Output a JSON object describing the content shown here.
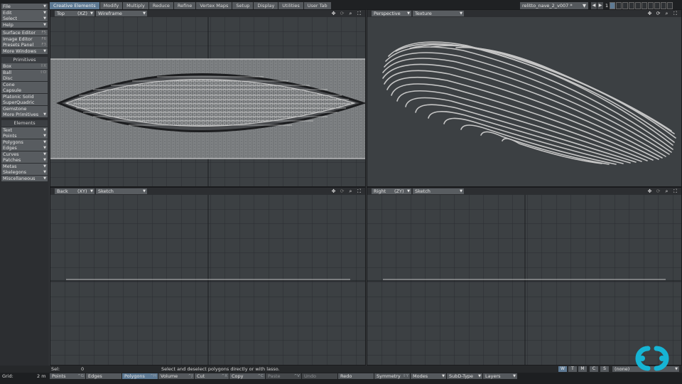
{
  "topbar": {
    "tabs": [
      {
        "label": "Creative Elements",
        "active": true
      },
      {
        "label": "Modify"
      },
      {
        "label": "Multiply"
      },
      {
        "label": "Reduce"
      },
      {
        "label": "Refine"
      },
      {
        "label": "Vertex Maps"
      },
      {
        "label": "Setup"
      },
      {
        "label": "Display"
      },
      {
        "label": "Utilities"
      },
      {
        "label": "User Tab"
      }
    ],
    "scene_name": "relitto_nave_2_v007 *",
    "layer_number": "1"
  },
  "toolbar": {
    "menus": [
      {
        "label": "File",
        "key": ""
      },
      {
        "label": "Edit",
        "key": ""
      },
      {
        "label": "Select",
        "key": ""
      },
      {
        "label": "Help",
        "key": ""
      }
    ],
    "panels": [
      {
        "label": "Surface Editor",
        "key": "F5"
      },
      {
        "label": "Image Editor",
        "key": "F6"
      },
      {
        "label": "Presets Panel",
        "key": "F3"
      },
      {
        "label": "More Windows",
        "key": ""
      }
    ],
    "primitives_title": "Primitives",
    "primitives": [
      {
        "label": "Box",
        "key": "⇧X"
      },
      {
        "label": "Ball",
        "key": "⇧O"
      },
      {
        "label": "Disc",
        "key": ""
      },
      {
        "label": "Cone",
        "key": ""
      },
      {
        "label": "Capsule",
        "key": ""
      },
      {
        "label": "Platonic Solid",
        "key": ""
      },
      {
        "label": "SuperQuadric",
        "key": ""
      },
      {
        "label": "Gemstone",
        "key": ""
      },
      {
        "label": "More Primitives",
        "key": ""
      }
    ],
    "elements_title": "Elements",
    "elements": [
      {
        "label": "Text"
      },
      {
        "label": "Points"
      },
      {
        "label": "Polygons"
      },
      {
        "label": "Edges"
      },
      {
        "label": "Curves"
      },
      {
        "label": "Patches"
      },
      {
        "label": "Metas"
      },
      {
        "label": "Skelegons"
      },
      {
        "label": "Miscellaneous"
      }
    ]
  },
  "viewports": {
    "top_left": {
      "view": "Top",
      "axis": "(XZ)",
      "mode": "Wireframe"
    },
    "top_right": {
      "view": "Perspective",
      "mode": "Texture"
    },
    "bottom_left": {
      "view": "Back",
      "axis": "(XY)",
      "mode": "Sketch"
    },
    "bottom_right": {
      "view": "Right",
      "axis": "(ZY)",
      "mode": "Sketch"
    }
  },
  "infobar": {
    "sel_label": "Sel:",
    "sel_value": "0",
    "hint": "Select and deselect polygons directly or with lasso.",
    "view_buttons": [
      "W",
      "T",
      "M",
      "C",
      "S"
    ],
    "active_view_button": "W",
    "none_select": "(none)"
  },
  "bottombar": {
    "grid_label": "Grid:",
    "grid_value": "2 m",
    "modes": [
      {
        "label": "Points",
        "key": "^G"
      },
      {
        "label": "Edges",
        "key": ""
      },
      {
        "label": "Polygons",
        "key": "^H",
        "active": true
      },
      {
        "label": "Volume",
        "key": "^J"
      },
      {
        "label": "Cut",
        "key": "^X"
      },
      {
        "label": "Copy",
        "key": "^C"
      },
      {
        "label": "Paste",
        "key": "^V"
      },
      {
        "label": "Undo",
        "key": ""
      },
      {
        "label": "Redo",
        "key": ""
      },
      {
        "label": "Symmetry",
        "key": "⇧Y"
      },
      {
        "label": "Modes",
        "key": ""
      },
      {
        "label": "SubD-Type",
        "key": ""
      },
      {
        "label": "Layers",
        "key": ""
      }
    ]
  },
  "icons": {
    "move": "move-view-icon",
    "rotate": "rotate-view-icon",
    "zoom": "zoom-view-icon",
    "maximize": "maximize-view-icon"
  },
  "colors": {
    "accent": "#5e7a94",
    "logo": "#16b4d4",
    "viewport_bg": "#3c4043"
  }
}
